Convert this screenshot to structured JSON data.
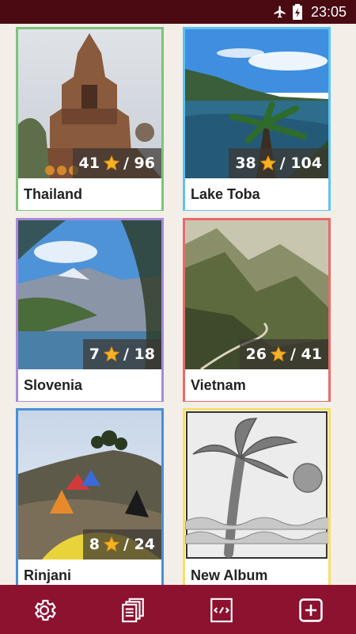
{
  "status": {
    "time": "23:05"
  },
  "albums": [
    {
      "name": "Thailand",
      "starred": "41",
      "total": "/ 96",
      "border": "#7dc47a"
    },
    {
      "name": "Lake Toba",
      "starred": "38",
      "total": "/ 104",
      "border": "#5ec3f0"
    },
    {
      "name": "Slovenia",
      "starred": "7",
      "total": "/ 18",
      "border": "#a88ad8"
    },
    {
      "name": "Vietnam",
      "starred": "26",
      "total": "/ 41",
      "border": "#e86a6a"
    },
    {
      "name": "Rinjani",
      "starred": "8",
      "total": "/ 24",
      "border": "#4a8fd8"
    },
    {
      "name": "New Album",
      "border": "#f5e06a"
    }
  ],
  "toolbar": {
    "icons": [
      "gear-icon",
      "documents-icon",
      "code-file-icon",
      "add-icon"
    ]
  },
  "colors": {
    "statusbar": "#4a0a12",
    "toolbar": "#8c1230",
    "background": "#f3eee7"
  }
}
